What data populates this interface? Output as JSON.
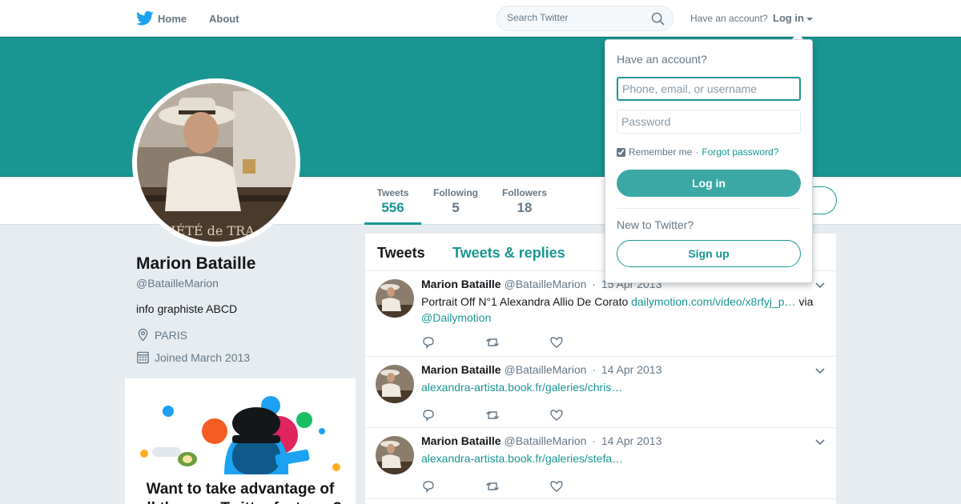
{
  "nav": {
    "home_label": "Home",
    "about_label": "About",
    "search_placeholder": "Search Twitter",
    "have_account": "Have an account?",
    "login_label": "Log in"
  },
  "profile": {
    "name": "Marion Bataille",
    "handle": "@BatailleMarion",
    "bio": "info graphiste ABCD",
    "location": "PARIS",
    "joined": "Joined March 2013",
    "stats": [
      {
        "label": "Tweets",
        "value": "556"
      },
      {
        "label": "Following",
        "value": "5"
      },
      {
        "label": "Followers",
        "value": "18"
      }
    ]
  },
  "promo": {
    "title": "Want to take advantage of all the new Twitter features?"
  },
  "timeline": {
    "tabs": [
      "Tweets",
      "Tweets & replies"
    ],
    "tweets": [
      {
        "name": "Marion Bataille",
        "handle": "@BatailleMarion",
        "dot": "·",
        "time": "15 Apr 2013",
        "text": "Portrait Off N°1 Alexandra Allio De Corato ",
        "link": "dailymotion.com/video/x8rfyj_p…",
        "text_after": " via ",
        "mention": "@Dailymotion"
      },
      {
        "name": "Marion Bataille",
        "handle": "@BatailleMarion",
        "dot": "·",
        "time": "14 Apr 2013",
        "link": "alexandra-artista.book.fr/galeries/chris…"
      },
      {
        "name": "Marion Bataille",
        "handle": "@BatailleMarion",
        "dot": "·",
        "time": "14 Apr 2013",
        "link": "alexandra-artista.book.fr/galeries/stefa…"
      }
    ]
  },
  "login_dropdown": {
    "title": "Have an account?",
    "username_placeholder": "Phone, email, or username",
    "password_placeholder": "Password",
    "remember_label": "Remember me",
    "separator": " · ",
    "forgot_label": "Forgot password?",
    "login_button": "Log in",
    "new_label": "New to Twitter?",
    "signup_button": "Sign up",
    "remember_checked": true
  },
  "colors": {
    "accent": "#199692",
    "banner": "#199692",
    "muted": "#657786",
    "background": "#e6ecf0"
  },
  "icons": {
    "logo": "twitter-bird-icon",
    "search": "search-icon",
    "location": "location-pin-icon",
    "calendar": "calendar-icon",
    "reply": "reply-icon",
    "retweet": "retweet-icon",
    "like": "heart-icon",
    "more": "chevron-down-icon"
  }
}
